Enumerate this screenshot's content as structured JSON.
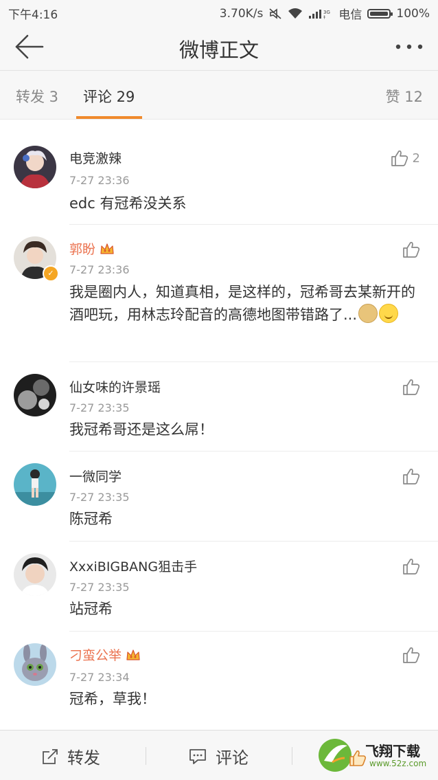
{
  "status_bar": {
    "time": "下午4:16",
    "net_speed": "3.70K/s",
    "carrier": "电信",
    "battery": "100%"
  },
  "nav": {
    "title": "微博正文",
    "back_icon": "back-arrow-icon",
    "more_icon": "more-dots-icon"
  },
  "tabs": {
    "repost": "转发 3",
    "comment": "评论 29",
    "like": "赞 12"
  },
  "comments": [
    {
      "name": "电竞激辣",
      "time": "7-27 23:36",
      "text": "edc 有冠希没关系",
      "likes": "2"
    },
    {
      "name": "郭盼",
      "time": "7-27 23:36",
      "text": "我是圈内人，知道真相，是这样的，冠希哥去某新开的酒吧玩，用林志玲配音的高德地图带错路了...",
      "likes": ""
    },
    {
      "name": "仙女味的许景瑶",
      "time": "7-27 23:35",
      "text": "我冠希哥还是这么屌！",
      "likes": ""
    },
    {
      "name": "一微同学",
      "time": "7-27 23:35",
      "text": "陈冠希",
      "likes": ""
    },
    {
      "name": "XxxiBIGBANG狙击手",
      "time": "7-27 23:35",
      "text": "站冠希",
      "likes": ""
    },
    {
      "name": "刁蛮公举",
      "time": "7-27 23:34",
      "text": "冠希，草我！",
      "likes": ""
    }
  ],
  "bottom_bar": {
    "repost": "转发",
    "comment": "评论"
  },
  "watermark": {
    "text": "飞翔下载",
    "url": "www.52z.com"
  },
  "colors": {
    "accent": "#f08a2c",
    "vip_name": "#eb7350"
  }
}
